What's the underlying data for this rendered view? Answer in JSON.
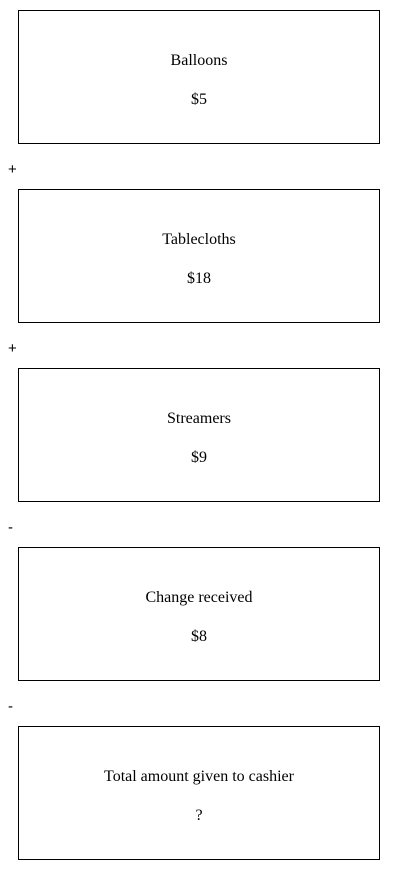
{
  "items": [
    {
      "label": "Balloons",
      "value": "$5"
    },
    {
      "label": "Tablecloths",
      "value": "$18"
    },
    {
      "label": "Streamers",
      "value": "$9"
    },
    {
      "label": "Change received",
      "value": "$8"
    },
    {
      "label": "Total amount given to cashier",
      "value": "?"
    }
  ],
  "operators": [
    "+",
    "+",
    "-",
    "-"
  ]
}
